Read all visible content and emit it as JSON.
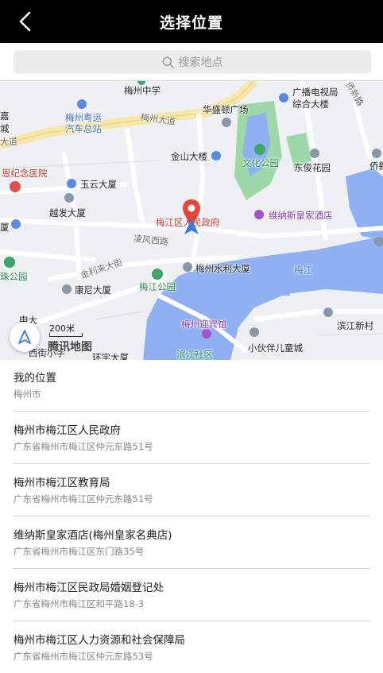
{
  "header": {
    "title": "选择位置"
  },
  "search": {
    "placeholder": "搜索地点"
  },
  "map": {
    "labels": {
      "l_top1": "梅州中学",
      "l_top2": "广播电视局",
      "l_top3": "综合大楼",
      "l_top4": "华盛顿广场",
      "l_top5": "侨新路",
      "l_top6": "梅州粤运",
      "l_top7": "汽车总站",
      "l_top8": "梅州大道",
      "l_top9": "金山大楼",
      "l_top10": "文化公园",
      "l_top11": "东俊花园",
      "l_top12": "侨新",
      "l_top13": "恩纪念医院",
      "l_top14": "玉云大厦",
      "l_top15": "越发大厦",
      "l_top16": "梅江区人民政府",
      "l_top17": "维纳斯皇家酒店",
      "l_top18": "凌风西路",
      "l_top19": "金利来大街",
      "l_top20": "梅州水利大厦",
      "l_top21": "梅江",
      "l_top22": "梅江公园",
      "l_top23": "康尼大厦",
      "l_top24": "梅州迎宾馆",
      "l_top25": "滨江新村",
      "l_top26": "小伙伴儿童城",
      "l_top27": "滨江社区",
      "l_top28": "申大",
      "l_top29": "西街小学",
      "l_top30": "环宇大厦",
      "l_top31": "珠公园",
      "l_top32": "嘉",
      "l_top33": "大道",
      "l_top34": "厦",
      "l_top35": "城"
    },
    "scale_text": "200米",
    "brand": "腾讯地图"
  },
  "results": [
    {
      "name": "我的位置",
      "address": "梅州市"
    },
    {
      "name": "梅州市梅江区人民政府",
      "address": "广东省梅州市梅江区仲元东路51号"
    },
    {
      "name": "梅州市梅江区教育局",
      "address": "广东省梅州市梅江区仲元东路51号"
    },
    {
      "name": "维纳斯皇家酒店(梅州皇家名典店)",
      "address": "广东省梅州市梅江区东门路35号"
    },
    {
      "name": "梅州市梅江区民政局婚姻登记处",
      "address": "广东省梅州市梅江区和平路18-3"
    },
    {
      "name": "梅州市梅江区人力资源和社会保障局",
      "address": "广东省梅州市梅江区仲元东路53号"
    }
  ],
  "colors": {
    "header_bg": "#000000",
    "water": "#8fb0f2",
    "park": "#9ed8a8",
    "road_major": "#f7e7a8",
    "pin": "#e8453c",
    "nav_arrow": "#3a7be0"
  },
  "icons": [
    "back-arrow-icon",
    "search-icon",
    "location-pin-icon",
    "navigation-arrow-icon",
    "locate-me-icon"
  ]
}
